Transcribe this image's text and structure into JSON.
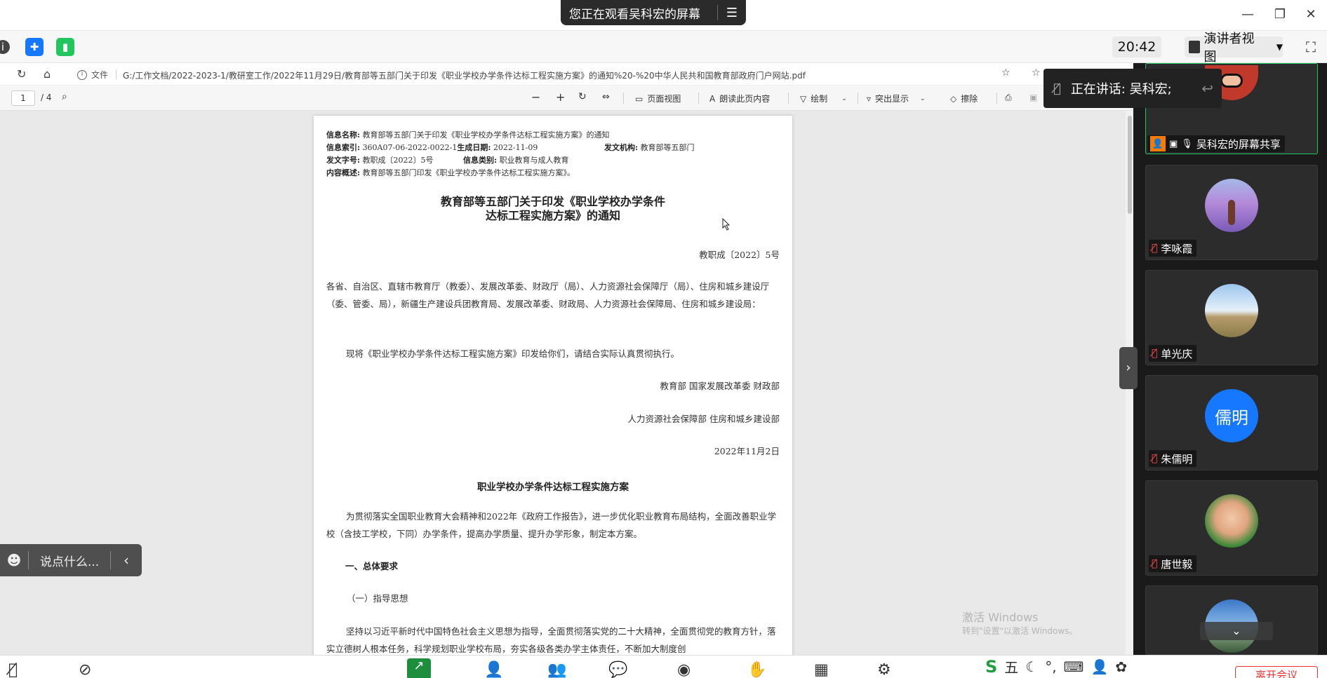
{
  "banner": {
    "text": "您正在观看吴科宏的屏幕",
    "menu_icon": "menu-icon"
  },
  "meeting_toolbar": {
    "time": "20:42",
    "view_label": "演讲者视图"
  },
  "browser": {
    "file_label": "文件",
    "url": "G:/工作文档/2022-2023-1/教研室工作/2022年11月29日/教育部等五部门关于印发《职业学校办学条件达标工程实施方案》的通知%20-%20中华人民共和国教育部政府门户网站.pdf"
  },
  "pdf_toolbar": {
    "page_current": "1",
    "page_total": "/ 4",
    "page_view": "页面视图",
    "read_aloud": "朗读此页内容",
    "draw": "绘制",
    "highlight": "突出显示",
    "erase": "擦除"
  },
  "document": {
    "meta": {
      "name_label": "信息名称:",
      "name_value": "教育部等五部门关于印发《职业学校办学条件达标工程实施方案》的通知",
      "index_label": "信息索引:",
      "index_value": "360A07-06-2022-0022-1",
      "date_label": "生成日期:",
      "date_value": "2022-11-09",
      "issuer_label": "发文机构:",
      "issuer_value": "教育部等五部门",
      "docno_label": "发文字号:",
      "docno_value": "教职成〔2022〕5号",
      "category_label": "信息类别:",
      "category_value": "职业教育与成人教育",
      "summary_label": "内容概述:",
      "summary_value": "教育部等五部门印发《职业学校办学条件达标工程实施方案》。"
    },
    "title_line1": "教育部等五部门关于印发《职业学校办学条件",
    "title_line2": "达标工程实施方案》的通知",
    "doc_number": "教职成〔2022〕5号",
    "addressees": "各省、自治区、直辖市教育厅（教委）、发展改革委、财政厅（局）、人力资源社会保障厅（局）、住房和城乡建设厅（委、管委、局），新疆生产建设兵团教育局、发展改革委、财政局、人力资源社会保障局、住房和城乡建设局：",
    "body1": "现将《职业学校办学条件达标工程实施方案》印发给你们，请结合实际认真贯彻执行。",
    "sign1": "教育部 国家发展改革委 财政部",
    "sign2": "人力资源社会保障部 住房和城乡建设部",
    "sign_date": "2022年11月2日",
    "section_title": "职业学校办学条件达标工程实施方案",
    "intro": "为贯彻落实全国职业教育大会精神和2022年《政府工作报告》，进一步优化职业教育布局结构，全面改善职业学校（含技工学校，下同）办学条件，提高办学质量、提升办学形象，制定本方案。",
    "heading1": "一、总体要求",
    "heading1_1": "（一）指导思想",
    "body2": "坚持以习近平新时代中国特色社会主义思想为指导，全面贯彻落实党的二十大精神，全面贯彻党的教育方针，落实立德树人根本任务，科学规划职业学校布局，夯实各级各类办学主体责任，不断加大制度创"
  },
  "participants": {
    "speaking": "正在讲话: 吴科宏;",
    "tiles": [
      {
        "name": "吴科宏的屏幕共享"
      },
      {
        "name": "李咏霞"
      },
      {
        "name": "单光庆"
      },
      {
        "name": "朱儒明",
        "initials": "儒明"
      },
      {
        "name": "唐世毅"
      }
    ]
  },
  "chat": {
    "placeholder": "说点什么..."
  },
  "watermark": {
    "line1": "激活 Windows",
    "line2": "转到\"设置\"以激活 Windows。"
  },
  "bottom": {
    "end_label": "离开会议"
  },
  "colors": {
    "accent_blue": "#1677ff",
    "mic_off_red": "#ff4d4f",
    "speaker_green": "#22c55e"
  }
}
